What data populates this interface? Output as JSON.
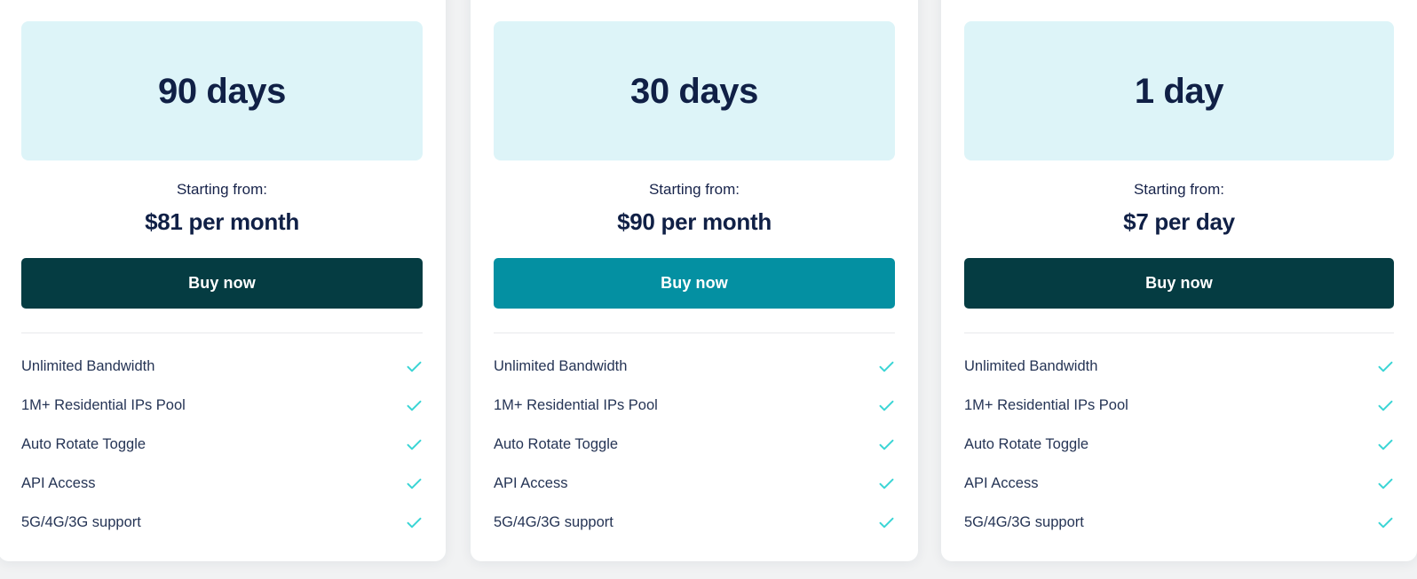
{
  "page": {
    "background_color": "#f1f2f3",
    "accent_color": "#3ad5d5",
    "dark_button_color": "#053c42",
    "teal_button_color": "#0490a2",
    "header_band_color": "#ddf4f8",
    "title_color": "#102046"
  },
  "plans": [
    {
      "title": "90 days",
      "price_prefix": "Starting from:",
      "price": "$81 per month",
      "buy_label": "Buy now",
      "button_style": "dark",
      "features": [
        {
          "label": "Unlimited Bandwidth",
          "included": "✓"
        },
        {
          "label": "1M+ Residential IPs Pool",
          "included": "✓"
        },
        {
          "label": "Auto Rotate Toggle",
          "included": "✓"
        },
        {
          "label": "API Access",
          "included": "✓"
        },
        {
          "label": "5G/4G/3G support",
          "included": "✓"
        }
      ]
    },
    {
      "title": "30 days",
      "price_prefix": "Starting from:",
      "price": "$90 per month",
      "buy_label": "Buy now",
      "button_style": "teal",
      "features": [
        {
          "label": "Unlimited Bandwidth",
          "included": "✓"
        },
        {
          "label": "1M+ Residential IPs Pool",
          "included": "✓"
        },
        {
          "label": "Auto Rotate Toggle",
          "included": "✓"
        },
        {
          "label": "API Access",
          "included": "✓"
        },
        {
          "label": "5G/4G/3G support",
          "included": "✓"
        }
      ]
    },
    {
      "title": "1 day",
      "price_prefix": "Starting from:",
      "price": "$7 per day",
      "buy_label": "Buy now",
      "button_style": "dark",
      "features": [
        {
          "label": "Unlimited Bandwidth",
          "included": "✓"
        },
        {
          "label": "1M+ Residential IPs Pool",
          "included": "✓"
        },
        {
          "label": "Auto Rotate Toggle",
          "included": "✓"
        },
        {
          "label": "API Access",
          "included": "✓"
        },
        {
          "label": "5G/4G/3G support",
          "included": "✓"
        }
      ]
    }
  ]
}
